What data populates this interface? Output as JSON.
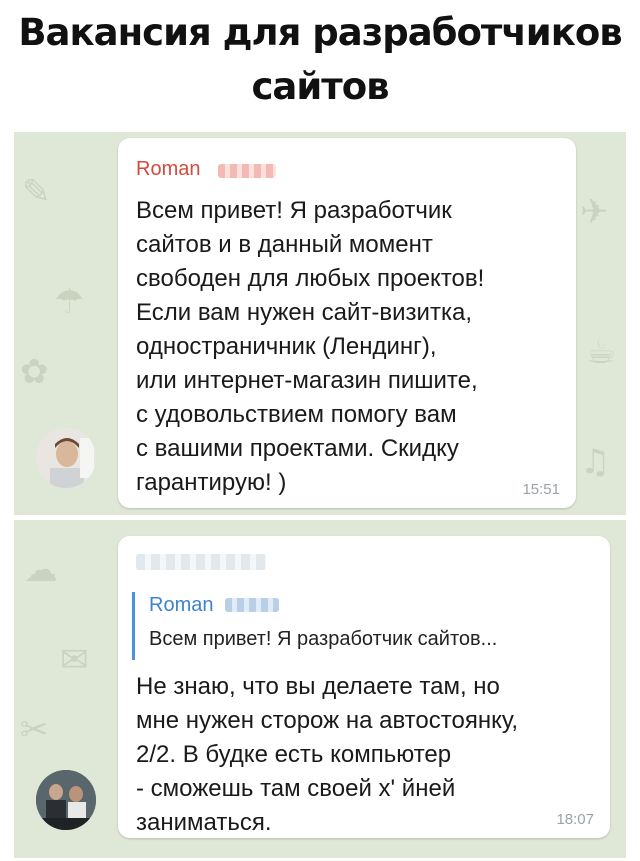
{
  "headline": {
    "line1": "Вакансия для разработчиков",
    "line2": "сайтов"
  },
  "messages": [
    {
      "sender": "Roman",
      "text": "Всем привет! Я разработчик\nсайтов и в данный момент\nсвободен для любых проектов!\nЕсли вам нужен сайт-визитка,\nодностраничник (Лендинг),\nили интернет-магазин пишите,\nс удовольствием помогу вам\nс вашими проектами. Скидку\nгарантирую! )",
      "time": "15:51"
    },
    {
      "reply_to": {
        "name": "Roman",
        "text": "Всем привет! Я разработчик сайтов..."
      },
      "text": "Не знаю, что вы делаете там, но\nмне нужен сторож на автостоянку,\n2/2. В будке есть компьютер\n- сможешь там своей х' йней\nзаниматься.",
      "time": "18:07"
    }
  ],
  "colors": {
    "chat_background": "#dfe7d6",
    "sender_name": "#d9483b",
    "reply_accent": "#4d93d9"
  }
}
